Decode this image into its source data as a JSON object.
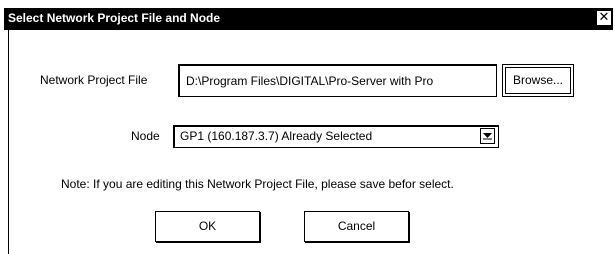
{
  "window": {
    "title": "Select Network Project File and Node",
    "close_glyph": "✕"
  },
  "project_file": {
    "label": "Network Project File",
    "value": "D:\\Program Files\\DIGITAL\\Pro-Server with Pro",
    "browse_label": "Browse..."
  },
  "node": {
    "label": "Node",
    "selected": "GP1 (160.187.3.7) Already Selected"
  },
  "note": "Note: If you are editing this Network Project File, please save befor select.",
  "buttons": {
    "ok": "OK",
    "cancel": "Cancel"
  },
  "icons": {
    "close": "close-icon",
    "dropdown": "chevron-down-icon"
  }
}
